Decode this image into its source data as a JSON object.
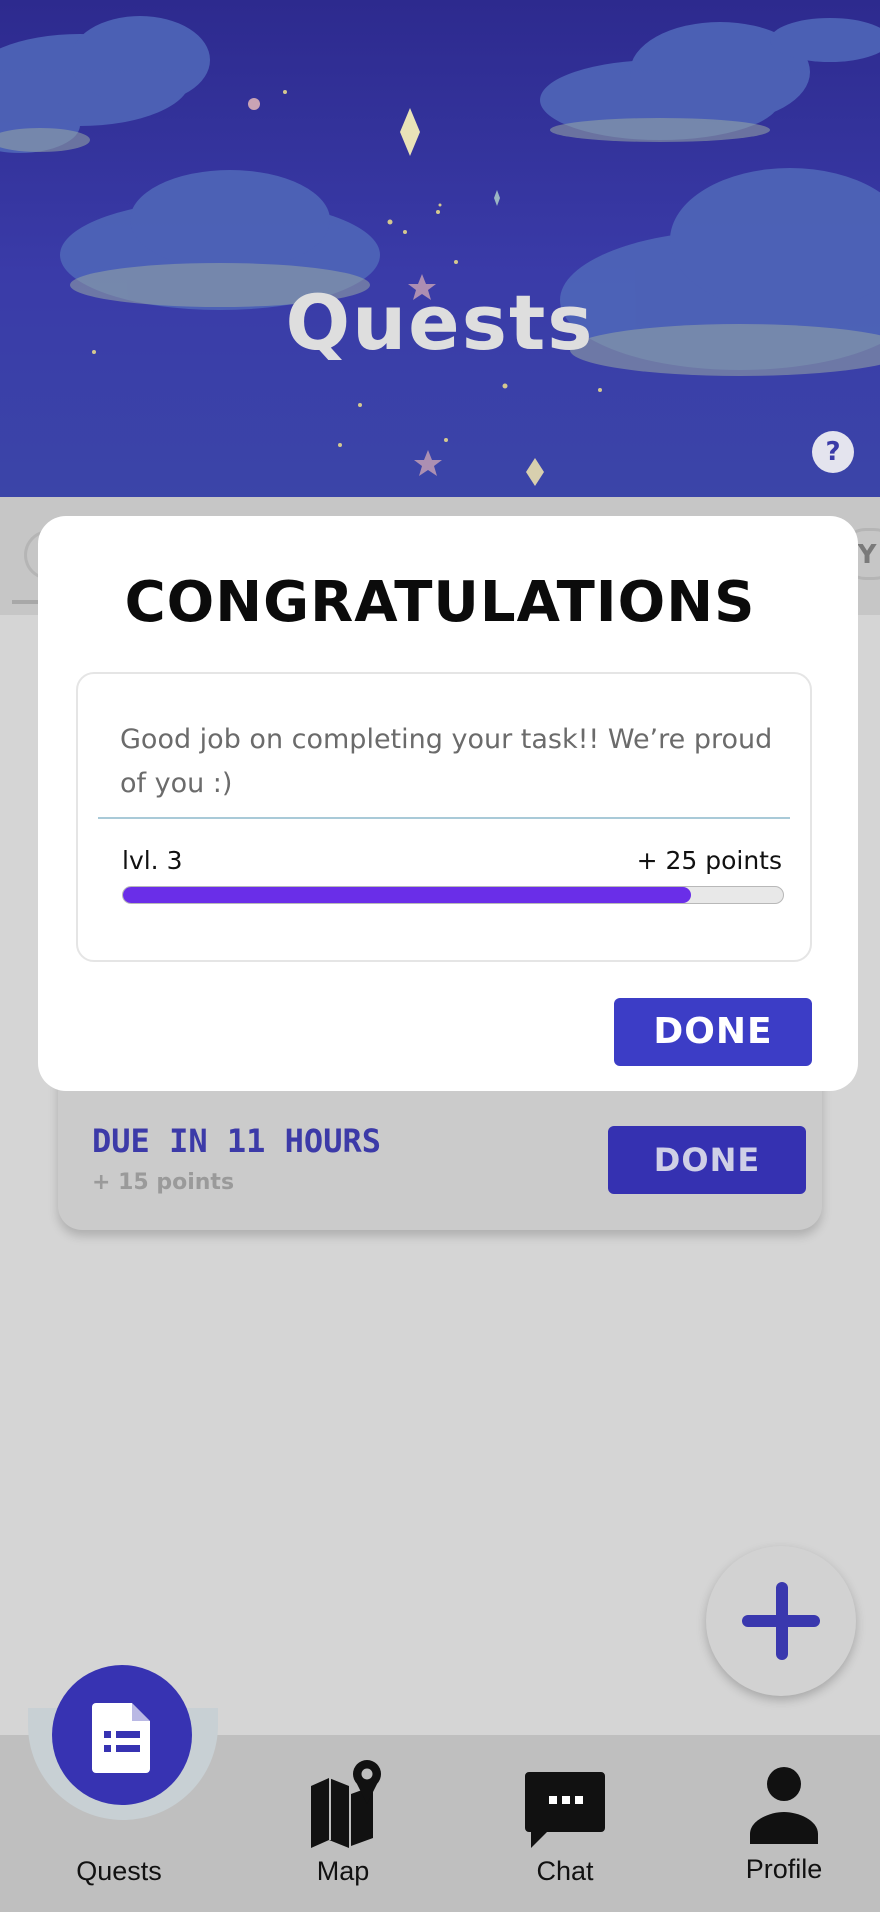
{
  "header": {
    "title": "Quests",
    "help_label": "?"
  },
  "tabs": {
    "right_partial_label": "IY"
  },
  "quest_card": {
    "due": "DUE IN 11 HOURS",
    "points": "+ 15 points",
    "done_label": "DONE"
  },
  "modal": {
    "title": "CONGRATULATIONS",
    "message": "Good job on completing your task!! We’re proud of you :)",
    "level": "lvl. 3",
    "points": "+ 25 points",
    "progress": 0.86,
    "done_label": "DONE",
    "progress_color": "#6a2ee8"
  },
  "fab": {
    "icon": "plus-icon"
  },
  "bottom_nav": {
    "items": [
      {
        "label": "Quests",
        "icon": "document-list-icon",
        "active": true
      },
      {
        "label": "Map",
        "icon": "map-pin-icon",
        "active": false
      },
      {
        "label": "Chat",
        "icon": "chat-bubble-icon",
        "active": false
      },
      {
        "label": "Profile",
        "icon": "person-icon",
        "active": false
      }
    ]
  },
  "colors": {
    "primary": "#3733b2",
    "header_bg": "#2d2a8e",
    "overlay_gray": "#d5d5d5"
  }
}
